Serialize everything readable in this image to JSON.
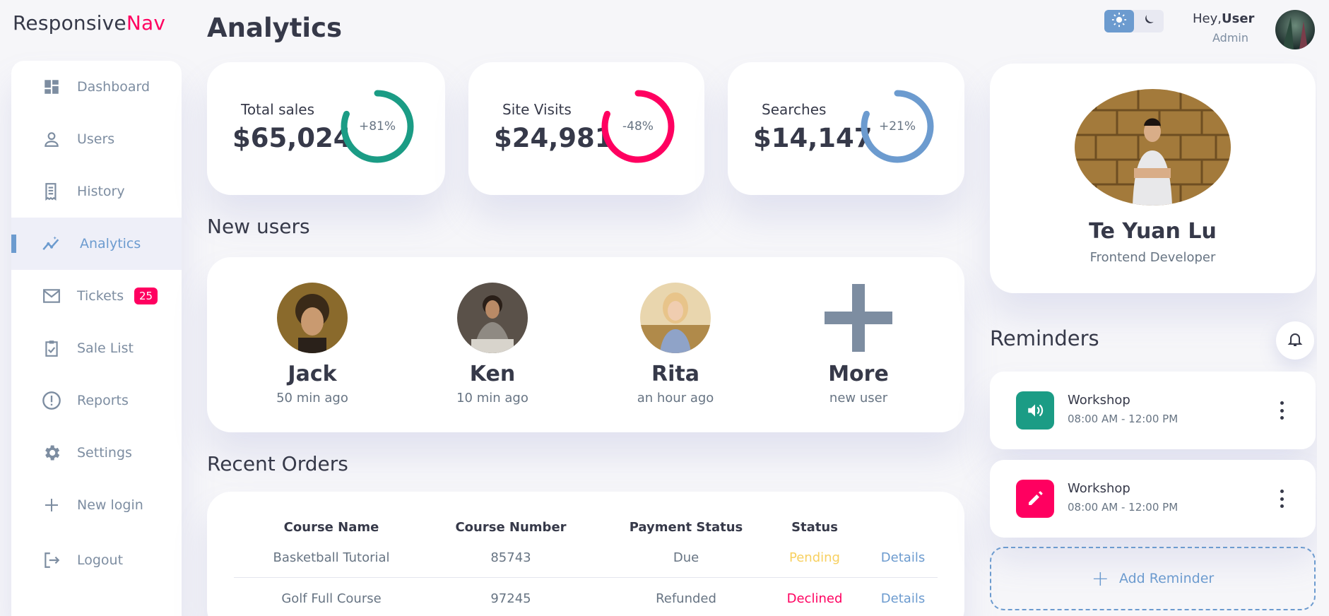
{
  "brand": {
    "name_part1": "Responsive",
    "name_part2": "Nav"
  },
  "sidebar": {
    "items": [
      {
        "label": "Dashboard",
        "icon": "dashboard-icon"
      },
      {
        "label": "Users",
        "icon": "user-icon"
      },
      {
        "label": "History",
        "icon": "receipt-icon"
      },
      {
        "label": "Analytics",
        "icon": "insights-icon",
        "active": true
      },
      {
        "label": "Tickets",
        "icon": "mail-icon",
        "badge": "25"
      },
      {
        "label": "Sale List",
        "icon": "clipboard-check-icon"
      },
      {
        "label": "Reports",
        "icon": "report-icon"
      },
      {
        "label": "Settings",
        "icon": "gear-icon"
      },
      {
        "label": "New login",
        "icon": "plus-icon"
      },
      {
        "label": "Logout",
        "icon": "logout-icon"
      }
    ]
  },
  "main": {
    "title": "Analytics",
    "stats": [
      {
        "label": "Total sales",
        "value": "$65,024",
        "percent": "+81%",
        "fraction": 0.81,
        "color": "#1b9c85"
      },
      {
        "label": "Site Visits",
        "value": "$24,981",
        "percent": "-48%",
        "fraction": 0.81,
        "color": "#ff0060"
      },
      {
        "label": "Searches",
        "value": "$14,147",
        "percent": "+21%",
        "fraction": 0.81,
        "color": "#6c9bcf"
      }
    ],
    "new_users_title": "New users",
    "new_users": [
      {
        "name": "Jack",
        "time": "50 min ago"
      },
      {
        "name": "Ken",
        "time": "10 min ago"
      },
      {
        "name": "Rita",
        "time": "an hour ago"
      },
      {
        "name": "More",
        "time": "new user"
      }
    ],
    "orders_title": "Recent Orders",
    "orders": {
      "columns": [
        "Course Name",
        "Course Number",
        "Payment Status",
        "Status"
      ],
      "rows": [
        {
          "course": "Basketball Tutorial",
          "number": "85743",
          "payment": "Due",
          "status": "Pending",
          "action": "Details"
        },
        {
          "course": "Golf Full Course",
          "number": "97245",
          "payment": "Refunded",
          "status": "Declined",
          "action": "Details"
        }
      ]
    }
  },
  "header": {
    "greeting": "Hey,",
    "username": "User",
    "role": "Admin",
    "theme_light_icon": "sun-icon",
    "theme_dark_icon": "moon-icon"
  },
  "profile": {
    "name": "Te Yuan Lu",
    "role": "Frontend Developer"
  },
  "reminders": {
    "title": "Reminders",
    "items": [
      {
        "name": "Workshop",
        "time": "08:00 AM - 12:00 PM",
        "icon": "volume-icon",
        "color": "#1b9c85"
      },
      {
        "name": "Workshop",
        "time": "08:00 AM - 12:00 PM",
        "icon": "edit-icon",
        "color": "#ff0060"
      }
    ],
    "add_label": "Add Reminder"
  },
  "colors": {
    "primary": "#6c9bcf",
    "danger": "#ff0060",
    "success": "#1b9c85",
    "warning": "#f7d060"
  }
}
